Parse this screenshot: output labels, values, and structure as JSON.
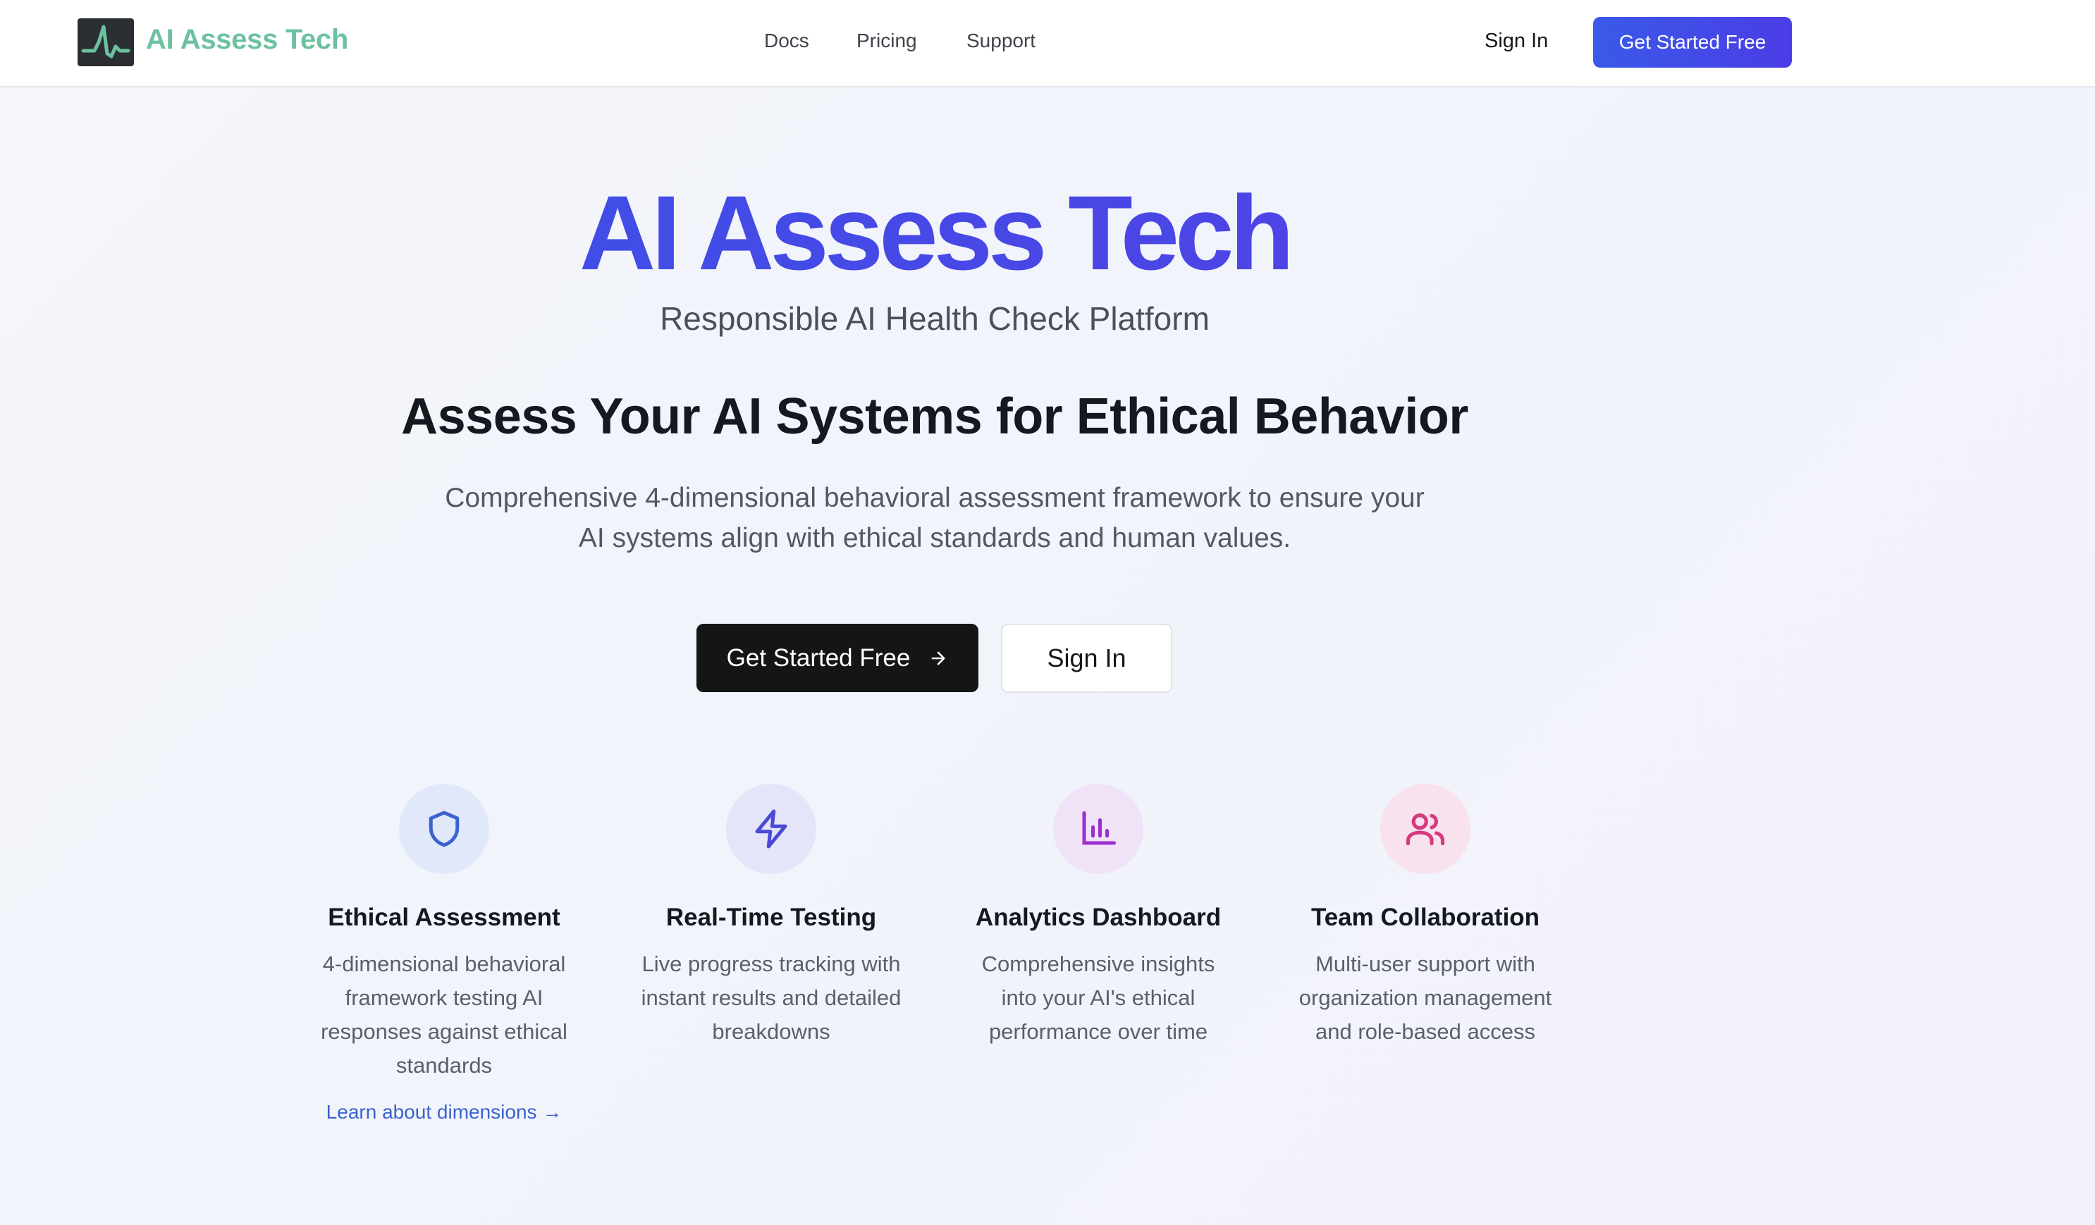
{
  "header": {
    "brand": "AI Assess Tech",
    "nav": [
      "Docs",
      "Pricing",
      "Support"
    ],
    "sign_in": "Sign In",
    "cta": "Get Started Free"
  },
  "hero": {
    "title": "AI Assess Tech",
    "subtitle": "Responsible AI Health Check Platform",
    "heading": "Assess Your AI Systems for Ethical Behavior",
    "description": "Comprehensive 4-dimensional behavioral assessment framework to ensure your AI systems align with ethical standards and human values.",
    "primary_button": "Get Started Free",
    "primary_button_icon": "arrow-right-icon",
    "secondary_button": "Sign In"
  },
  "features": [
    {
      "icon": "shield-icon",
      "color": "#3a63d1",
      "bg": "#e1e8f9",
      "title": "Ethical Assessment",
      "description": "4-dimensional behavioral framework testing AI responses against ethical standards",
      "link": "Learn about dimensions →"
    },
    {
      "icon": "lightning-icon",
      "color": "#4a4ad6",
      "bg": "#e4e5f8",
      "title": "Real-Time Testing",
      "description": "Live progress tracking with instant results and detailed breakdowns"
    },
    {
      "icon": "bar-chart-icon",
      "color": "#9c2fd1",
      "bg": "#f0e3f8",
      "title": "Analytics Dashboard",
      "description": "Comprehensive insights into your AI's ethical performance over time"
    },
    {
      "icon": "users-icon",
      "color": "#d63a7e",
      "bg": "#f8e2ee",
      "title": "Team Collaboration",
      "description": "Multi-user support with organization management and role-based access"
    }
  ]
}
